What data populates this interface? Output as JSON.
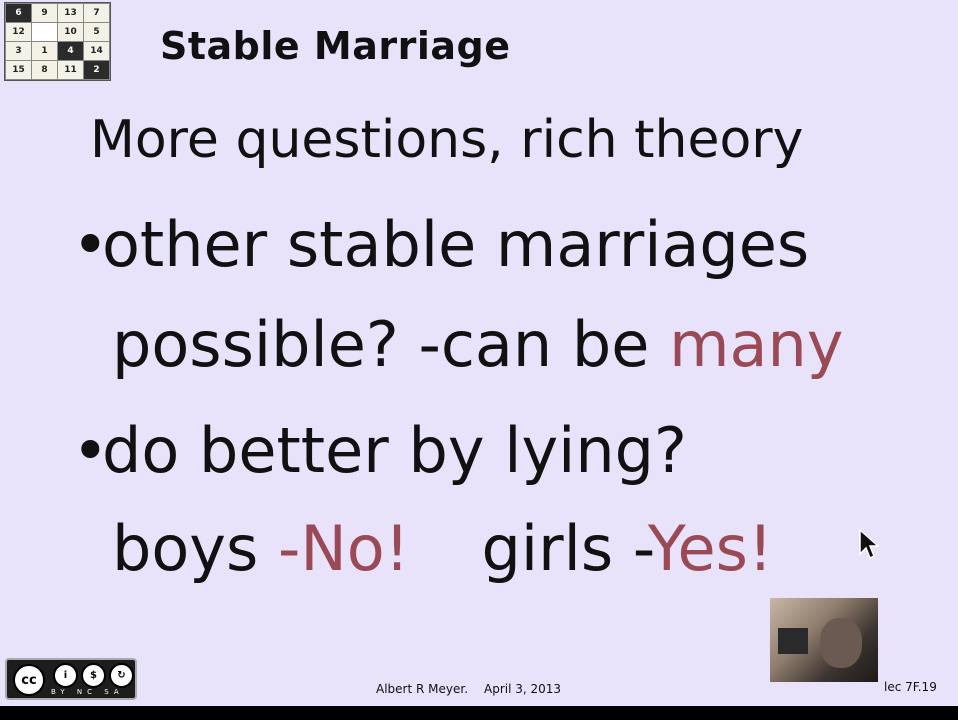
{
  "puzzle": {
    "tiles": [
      {
        "label": "6",
        "dark": true
      },
      {
        "label": "9",
        "dark": false
      },
      {
        "label": "13",
        "dark": false
      },
      {
        "label": "7",
        "dark": false
      },
      {
        "label": "12",
        "dark": false
      },
      {
        "label": "",
        "dark": false,
        "blank": true
      },
      {
        "label": "10",
        "dark": false
      },
      {
        "label": "5",
        "dark": false
      },
      {
        "label": "3",
        "dark": false
      },
      {
        "label": "1",
        "dark": false
      },
      {
        "label": "4",
        "dark": true
      },
      {
        "label": "14",
        "dark": false
      },
      {
        "label": "15",
        "dark": false
      },
      {
        "label": "8",
        "dark": false
      },
      {
        "label": "11",
        "dark": false
      },
      {
        "label": "2",
        "dark": true
      }
    ]
  },
  "slide": {
    "title": "Stable Marriage",
    "subtitle": "More questions, rich theory",
    "bullets": {
      "b1_bullet": "•",
      "b1_text": "other stable marriages",
      "b1_cont_text": "possible? -can be ",
      "b1_cont_accent": "many",
      "b2_bullet": "•",
      "b2_text": "do better by lying?",
      "b2_boys": "boys ",
      "b2_boys_answer": "-No!",
      "b2_girls": "girls -",
      "b2_girls_answer": "Yes!"
    }
  },
  "footer": {
    "author": "Albert R Meyer.",
    "date": "April 3, 2013",
    "lecture": "lec 7F.19"
  },
  "license": {
    "cc": "cc",
    "labels": "BY NC SA"
  },
  "colors": {
    "background": "#e8e2fb",
    "accent": "#9a4a55",
    "text": "#111111"
  }
}
